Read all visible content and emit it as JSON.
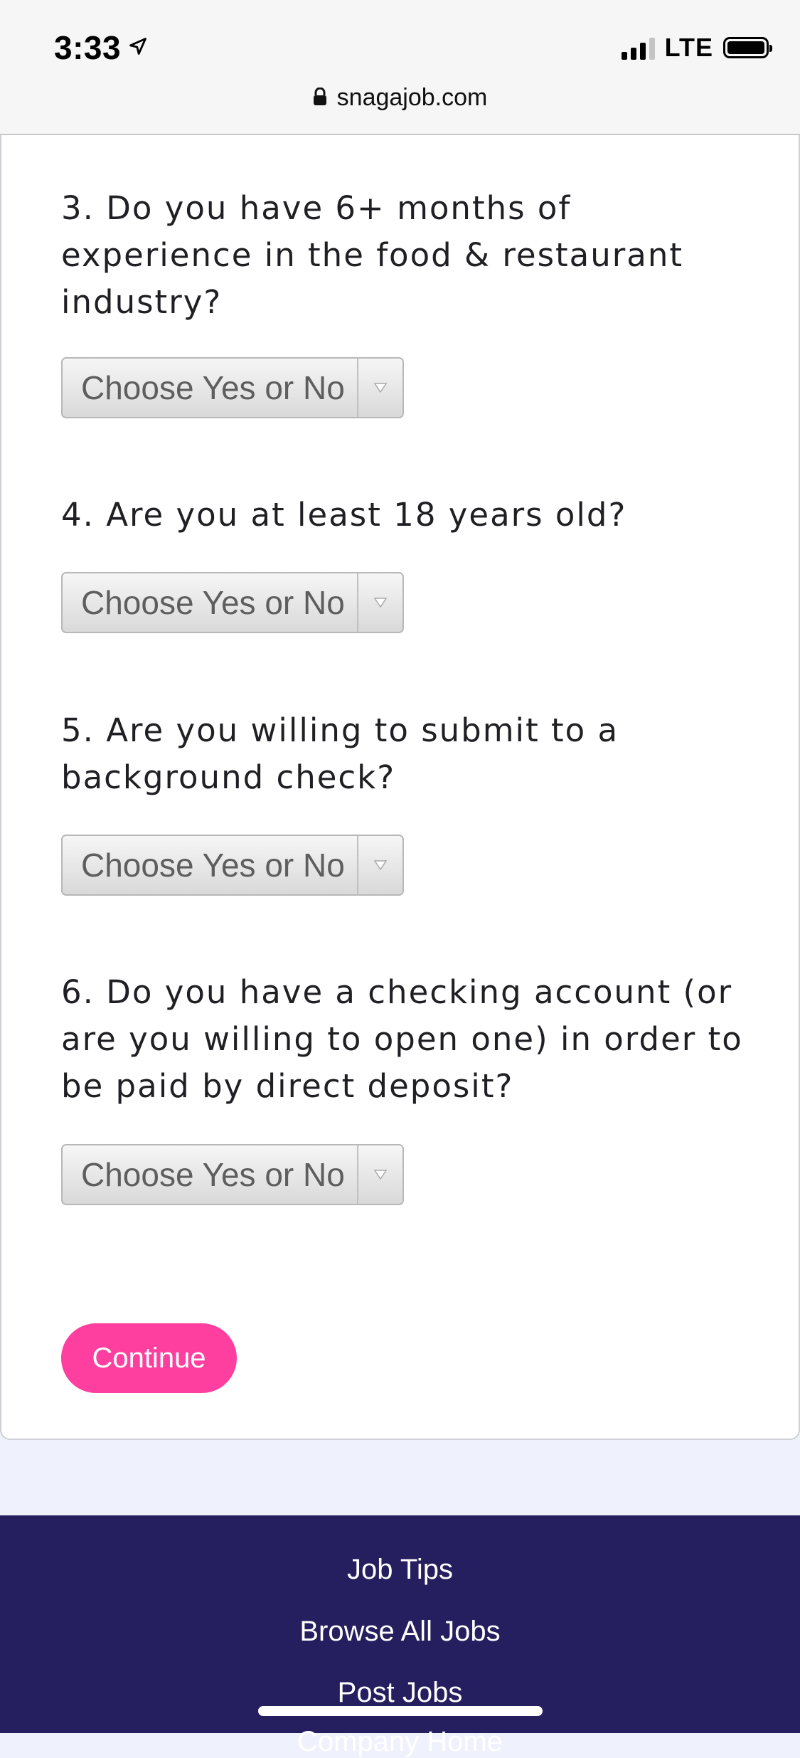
{
  "status_bar": {
    "time": "3:33",
    "network": "LTE",
    "location_icon": "location-arrow-icon",
    "battery_level": 1.0
  },
  "browser": {
    "url": "snagajob.com",
    "lock_icon": "lock-icon"
  },
  "questions": [
    {
      "text": "3. Do you have 6+ months of experience in the food & restaurant industry?",
      "select_value": "Choose Yes or No"
    },
    {
      "text": "4. Are you at least 18 years old?",
      "select_value": "Choose Yes or No"
    },
    {
      "text": "5. Are you willing to submit to a background check?",
      "select_value": "Choose Yes or No"
    },
    {
      "text": "6. Do you have a checking account (or are you willing to open one) in order to be paid by direct deposit?",
      "select_value": "Choose Yes or No"
    }
  ],
  "continue_label": "Continue",
  "colors": {
    "accent": "#ff3f9f",
    "footer_bg": "#251e5f",
    "page_bg": "#eff1fc"
  },
  "footer": {
    "links": [
      "Job Tips",
      "Browse All Jobs",
      "Post Jobs",
      "Company Home"
    ]
  }
}
